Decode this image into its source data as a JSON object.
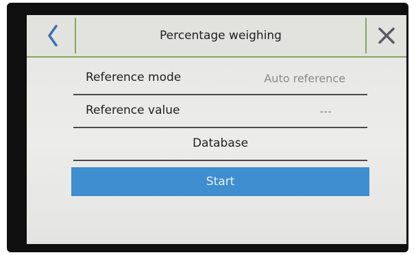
{
  "header": {
    "title": "Percentage weighing",
    "back_icon": "chevron-left-icon",
    "close_icon": "close-icon"
  },
  "settings": {
    "reference_mode": {
      "label": "Reference mode",
      "value": "Auto reference"
    },
    "reference_value": {
      "label": "Reference value",
      "value": "---"
    },
    "database": {
      "label": "Database"
    }
  },
  "actions": {
    "start_label": "Start"
  },
  "colors": {
    "accent_line": "#8aa55c",
    "start_button": "#3f8ecf",
    "icon_blue": "#3b6fb0",
    "close_grey": "#5a5a66"
  }
}
